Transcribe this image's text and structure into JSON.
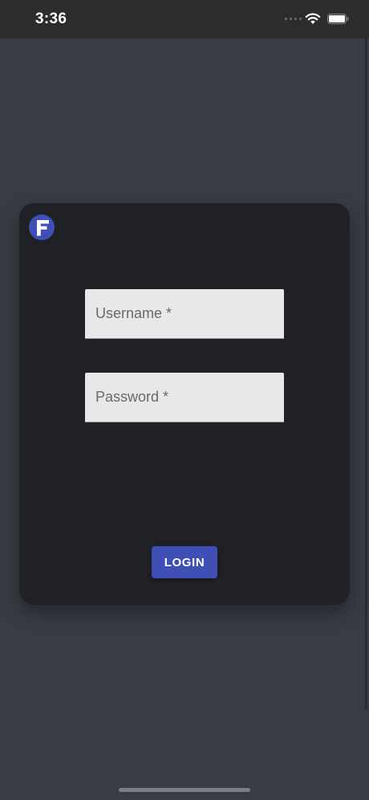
{
  "status_bar": {
    "time": "3:36",
    "wifi_icon": "wifi-icon",
    "battery_icon": "battery-icon"
  },
  "login_card": {
    "logo_icon": "app-logo-f",
    "username": {
      "label": "Username *",
      "value": ""
    },
    "password": {
      "label": "Password *",
      "value": ""
    },
    "login_label": "LOGIN"
  },
  "colors": {
    "background": "#383c44",
    "card": "#202124",
    "accent": "#3f4fb6",
    "field": "#e8e8e8"
  }
}
